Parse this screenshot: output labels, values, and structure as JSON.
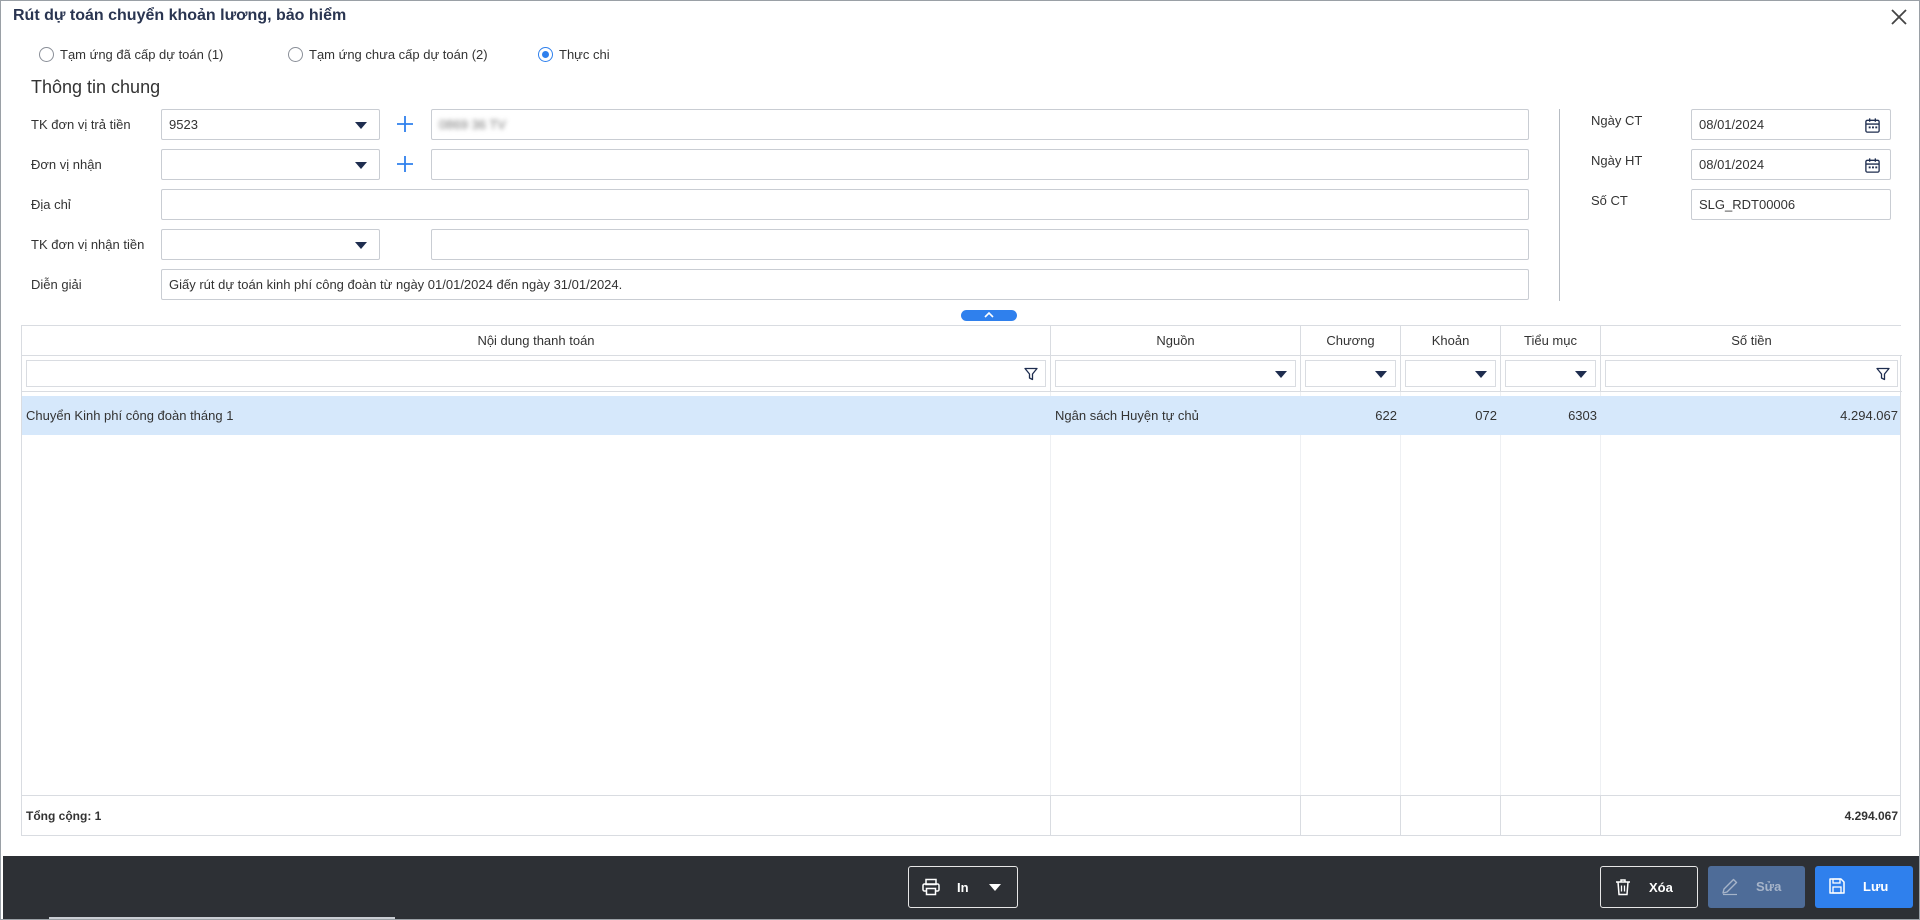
{
  "dialog": {
    "title": "Rút dự toán chuyển khoản lương, bảo hiểm"
  },
  "radios": [
    {
      "label": "Tạm ứng đã cấp dự toán (1)",
      "checked": false
    },
    {
      "label": "Tạm ứng chưa cấp dự toán (2)",
      "checked": false
    },
    {
      "label": "Thực chi",
      "checked": true
    }
  ],
  "general": {
    "section_title": "Thông tin chung",
    "tk_payer_label": "TK đơn vị trả tiền",
    "tk_payer_value": "9523",
    "tk_payer_name": "0869 36 TV",
    "recipient_label": "Đơn vị nhận",
    "recipient_value": "",
    "recipient_name": "",
    "address_label": "Địa chỉ",
    "address_value": "",
    "tk_recipient_label": "TK đơn vị nhận tiền",
    "tk_recipient_value": "",
    "tk_recipient_name": "",
    "description_label": "Diễn giải",
    "description_value": "Giấy rút dự toán kinh phí công đoàn từ ngày 01/01/2024 đến ngày 31/01/2024."
  },
  "voucher": {
    "date_ct_label": "Ngày CT",
    "date_ct_value": "08/01/2024",
    "date_ht_label": "Ngày HT",
    "date_ht_value": "08/01/2024",
    "number_label": "Số CT",
    "number_value": "SLG_RDT00006"
  },
  "grid": {
    "columns": [
      "Nội dung thanh toán",
      "Nguồn",
      "Chương",
      "Khoản",
      "Tiểu mục",
      "Số tiền"
    ],
    "rows": [
      {
        "content": "Chuyển Kinh phí công đoàn tháng 1",
        "source": "Ngân sách Huyện tự chủ",
        "chapter": "622",
        "item": "072",
        "subitem": "6303",
        "amount": "4.294.067"
      }
    ],
    "footer": {
      "total_label": "Tổng cộng: 1",
      "total_amount": "4.294.067"
    }
  },
  "toolbar": {
    "print_label": "In",
    "delete_label": "Xóa",
    "edit_label": "Sửa",
    "save_label": "Lưu"
  },
  "colors": {
    "accent": "#2f80ed",
    "selected_row": "#d6e8fb",
    "bottom_bar": "#2d3035",
    "title": "#2a3551"
  },
  "icons": [
    "close-icon",
    "plus-icon",
    "calendar-icon",
    "filter-icon",
    "chevron-up-icon",
    "printer-icon",
    "trash-icon",
    "pencil-icon",
    "save-icon"
  ]
}
